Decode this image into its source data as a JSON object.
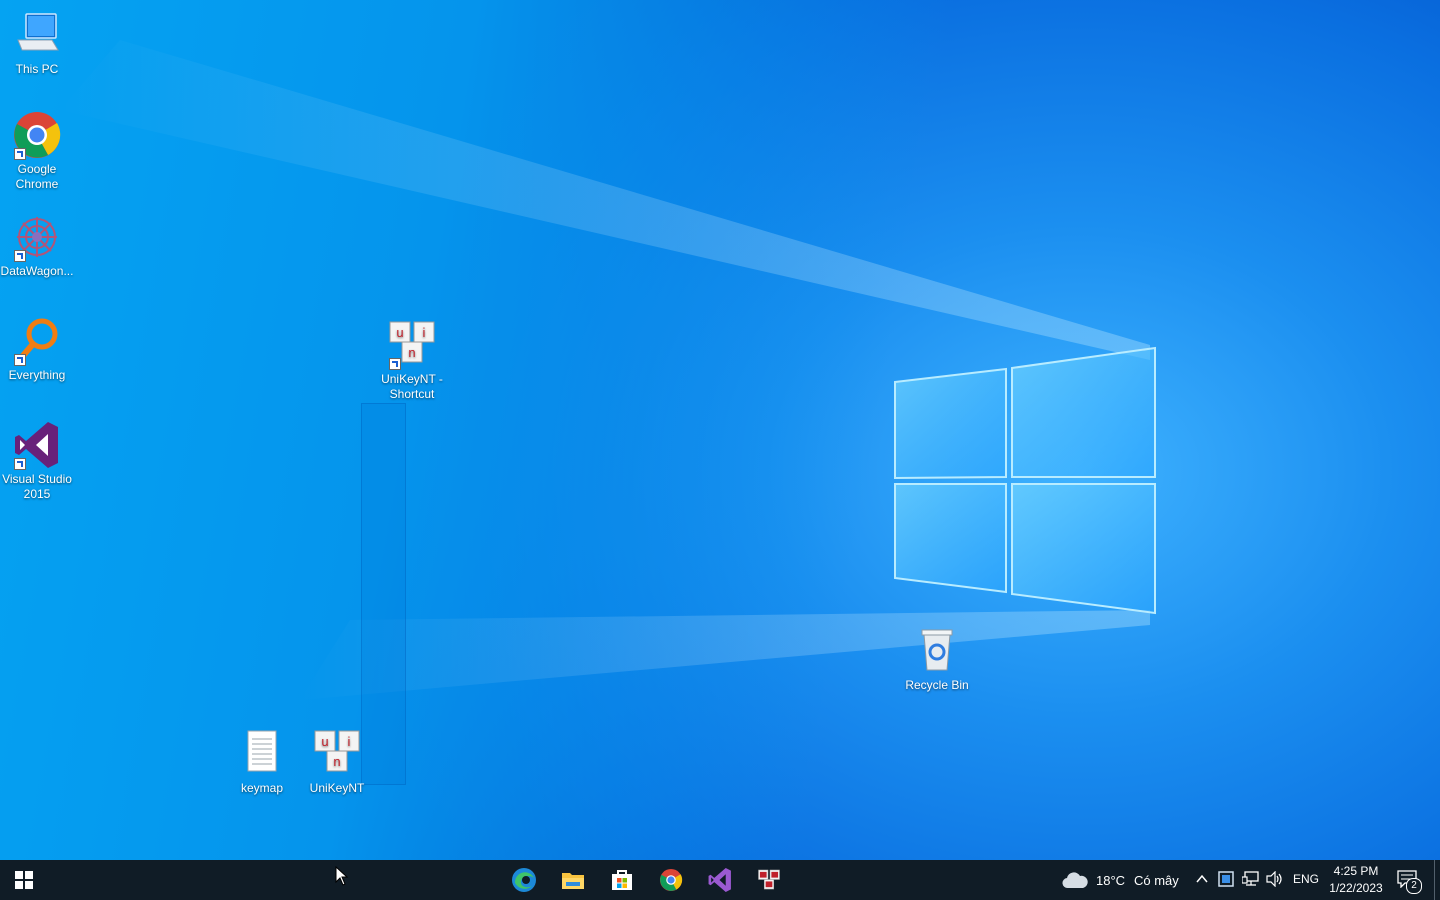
{
  "desktop": {
    "icons": [
      {
        "name": "This PC",
        "label": "This PC"
      },
      {
        "name": "Google Chrome",
        "label": "Google\nChrome"
      },
      {
        "name": "DataWagon",
        "label": "DataWagon..."
      },
      {
        "name": "Everything",
        "label": "Everything"
      },
      {
        "name": "Visual Studio 2015",
        "label": "Visual Studio\n2015"
      },
      {
        "name": "UniKeyNT - Shortcut",
        "label": "UniKeyNT -\nShortcut"
      },
      {
        "name": "Recycle Bin",
        "label": "Recycle Bin"
      },
      {
        "name": "keymap",
        "label": "keymap"
      },
      {
        "name": "UniKeyNT",
        "label": "UniKeyNT"
      }
    ]
  },
  "taskbar": {
    "pinned": [
      "start-icon",
      "edge-icon",
      "file-explorer-icon",
      "microsoft-store-icon",
      "chrome-icon",
      "visual-studio-icon",
      "unikey-icon"
    ],
    "weather": {
      "temp": "18°C",
      "condition": "Có mây"
    },
    "language": "ENG",
    "time": "4:25 PM",
    "date": "1/22/2023",
    "notification_count": "2"
  },
  "colors": {
    "taskbar": "#101c26",
    "wallpaper_accent": "#0a6fe0"
  }
}
